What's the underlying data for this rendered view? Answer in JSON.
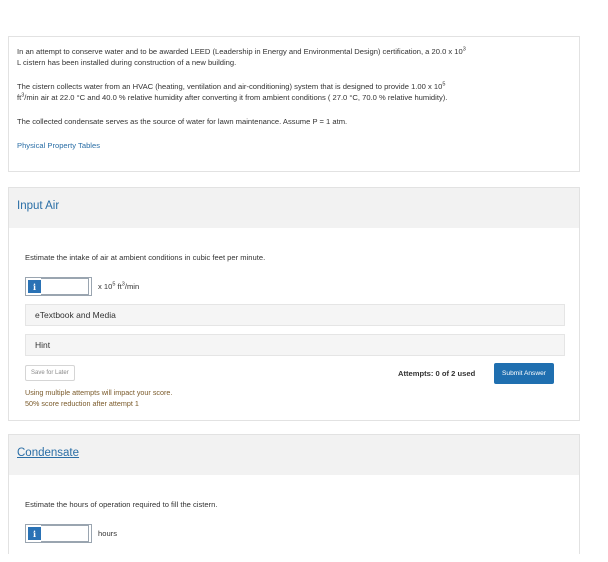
{
  "problem": {
    "p1_a": "In an attempt to conserve water and to be awarded LEED (Leadership in Energy and Environmental Design) certification, a 20.0 x 10",
    "p1_exp": "3",
    "p1_b": "L cistern has been installed during construction of a new building.",
    "p2_a": "The cistern collects water from an HVAC (heating, ventilation and air-conditioning) system that is designed to provide 1.00 x 10",
    "p2_exp1": "5",
    "p2_b": "ft",
    "p2_exp2": "3",
    "p2_c": "/min air at 22.0 °C and 40.0 % relative humidity after converting it from ambient conditions ( 27.0 °C, 70.0 % relative humidity).",
    "p3": "The collected condensate serves as the source of water for lawn maintenance. Assume P = 1 atm.",
    "link": "Physical Property Tables"
  },
  "part1": {
    "title": "Input Air",
    "question": "Estimate the intake of air at ambient conditions in cubic feet per minute.",
    "info_label": "i",
    "input_value": "",
    "unit_a": "x 10",
    "unit_exp1": "5",
    "unit_b": " ft",
    "unit_exp2": "3",
    "unit_c": "/min",
    "etextbook": "eTextbook and Media",
    "hint": "Hint",
    "save_label": "Save for Later",
    "attempts": "Attempts: 0 of 2 used",
    "submit_label": "Submit Answer",
    "note1": "Using multiple attempts will impact your score.",
    "note2": "50% score reduction after attempt 1"
  },
  "part2": {
    "title": "Condensate",
    "question": "Estimate the hours of operation required to fill the cistern.",
    "info_label": "i",
    "input_value": "",
    "unit": "hours"
  },
  "colors": {
    "accent": "#2a6ea6",
    "button": "#1f6fb0",
    "note": "#7a5a2a"
  }
}
